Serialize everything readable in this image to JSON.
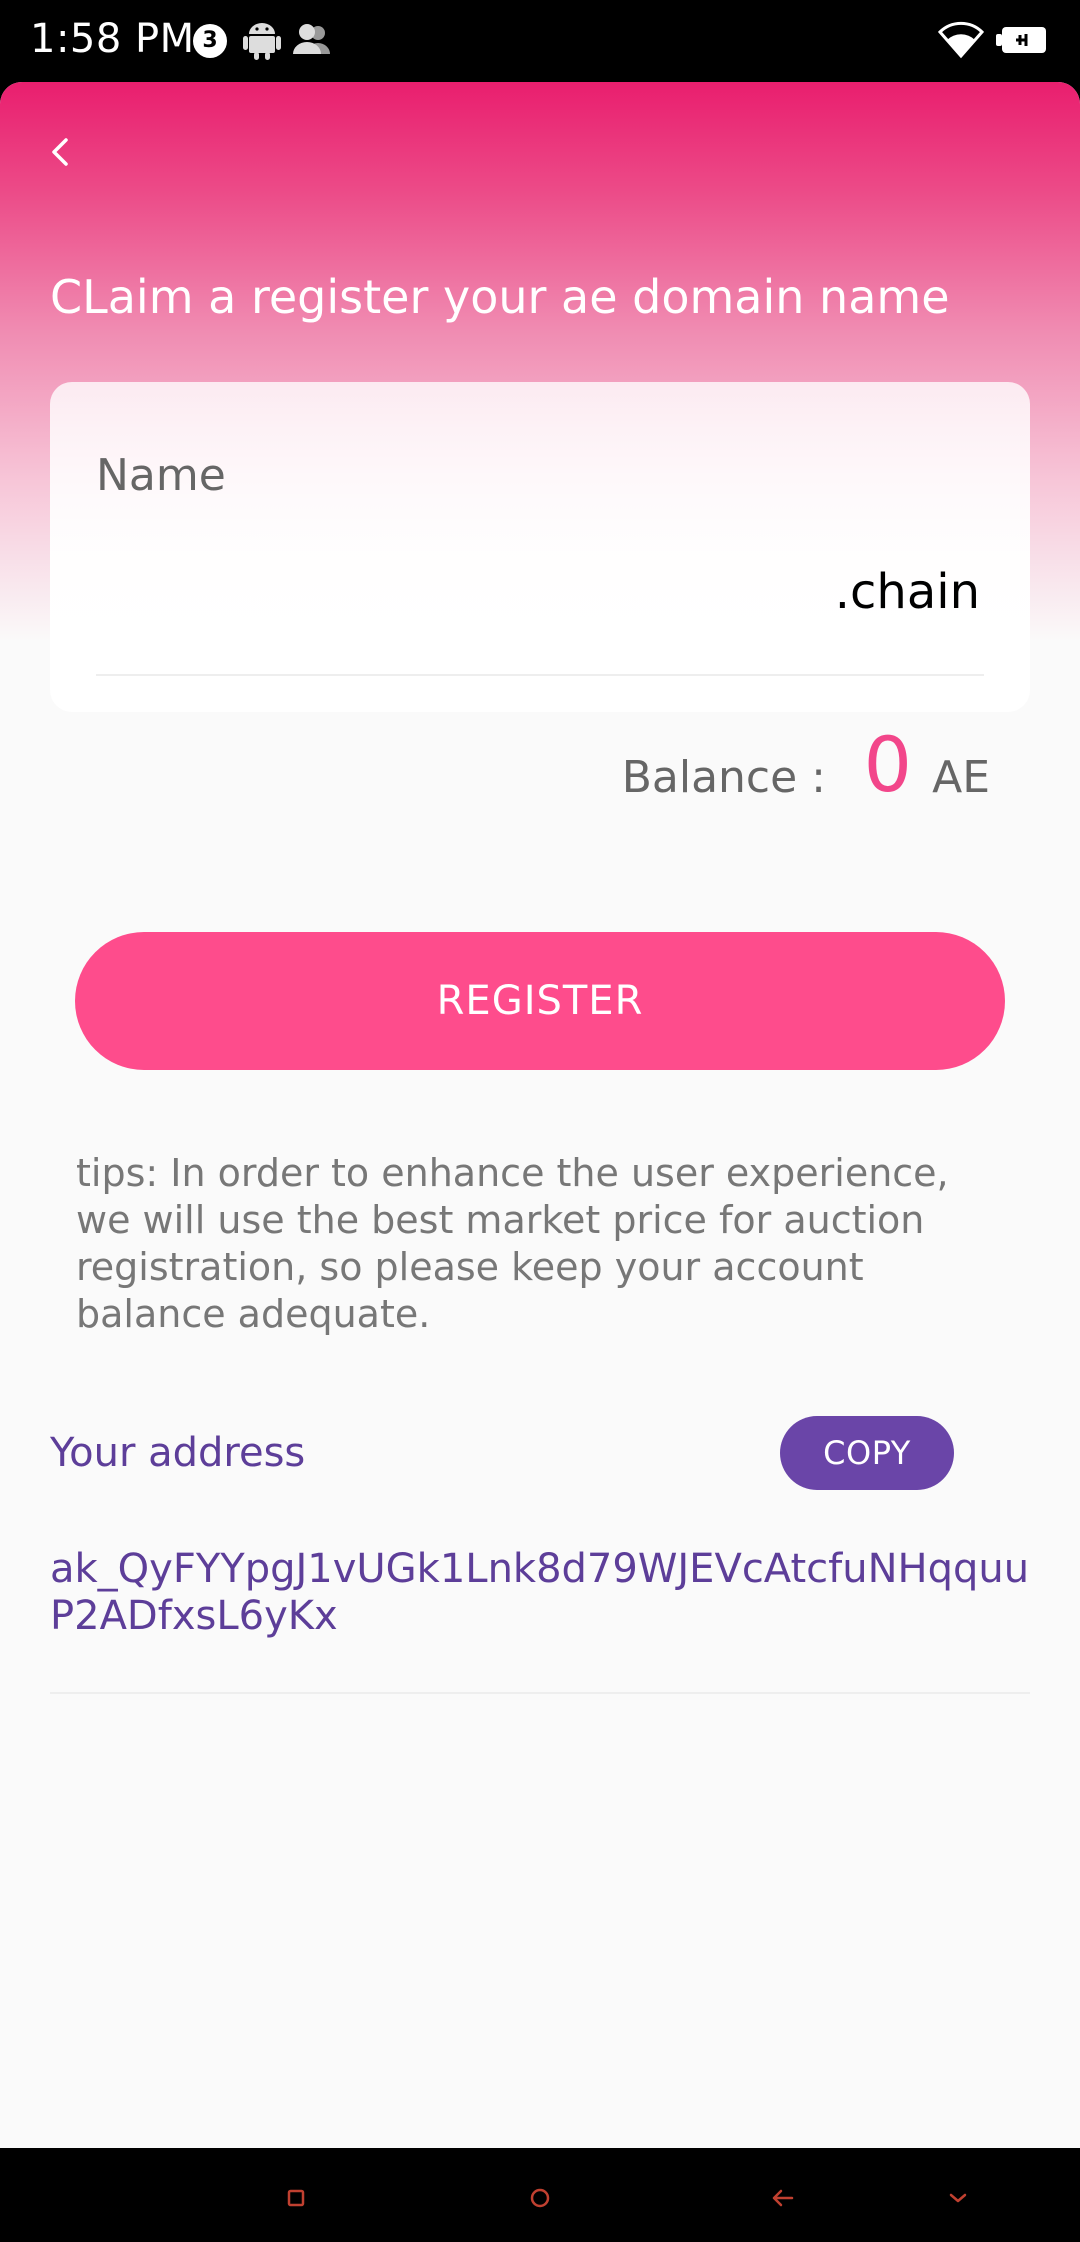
{
  "status_bar": {
    "time": "1:58 PM",
    "notification_count": "3",
    "icons": [
      "android-icon",
      "people-icon",
      "wifi-icon",
      "battery-icon"
    ]
  },
  "header": {
    "back_icon": "chevron-left-icon",
    "title": "CLaim a register your ae domain name"
  },
  "name_form": {
    "label": "Name",
    "value": "",
    "suffix": ".chain"
  },
  "balance": {
    "label": "Balance :",
    "value": "0",
    "unit": "AE"
  },
  "register_label": "REGISTER",
  "tips": "tips: In order to enhance the user experience, we will use the best market price for auction registration, so please keep your account balance adequate.",
  "address": {
    "label": "Your address",
    "copy_label": "COPY",
    "value": "ak_QyFYYpgJ1vUGk1Lnk8d79WJEVcAtcfuNHqquuP2ADfxsL6yKx"
  },
  "nav_bar": {
    "icons": [
      "recent-apps-icon",
      "home-icon",
      "back-icon",
      "hide-keyboard-icon"
    ]
  },
  "colors": {
    "brand_pink": "#e91e6e",
    "button_pink": "#fe4c8c",
    "balance_pink": "#f2468a",
    "purple": "#6a45a8",
    "text_purple": "#5d3e99"
  }
}
